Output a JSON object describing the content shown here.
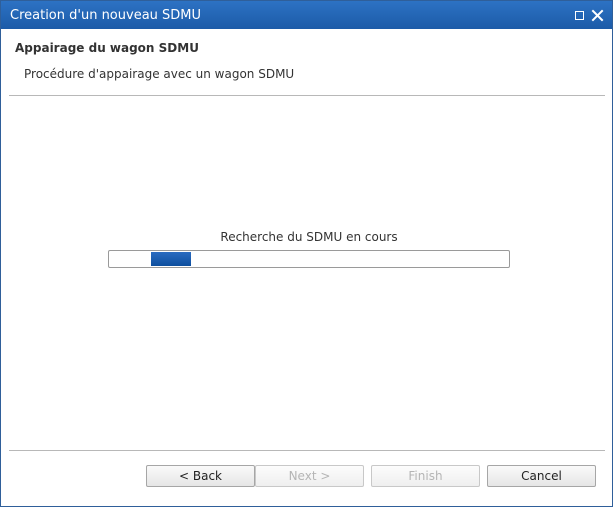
{
  "window": {
    "title": "Creation d'un nouveau SDMU"
  },
  "header": {
    "title": "Appairage du wagon SDMU",
    "description": "Procédure d'appairage avec un wagon SDMU"
  },
  "main": {
    "status_text": "Recherche du SDMU en cours",
    "progress": {
      "mode": "indeterminate"
    }
  },
  "buttons": {
    "back_label": "< Back",
    "next_label": "Next >",
    "finish_label": "Finish",
    "cancel_label": "Cancel"
  },
  "colors": {
    "titlebar": "#1f62b2",
    "progress_fill": "#0e4f9e"
  },
  "icons": {
    "maximize": "maximize-icon",
    "close": "close-icon"
  }
}
